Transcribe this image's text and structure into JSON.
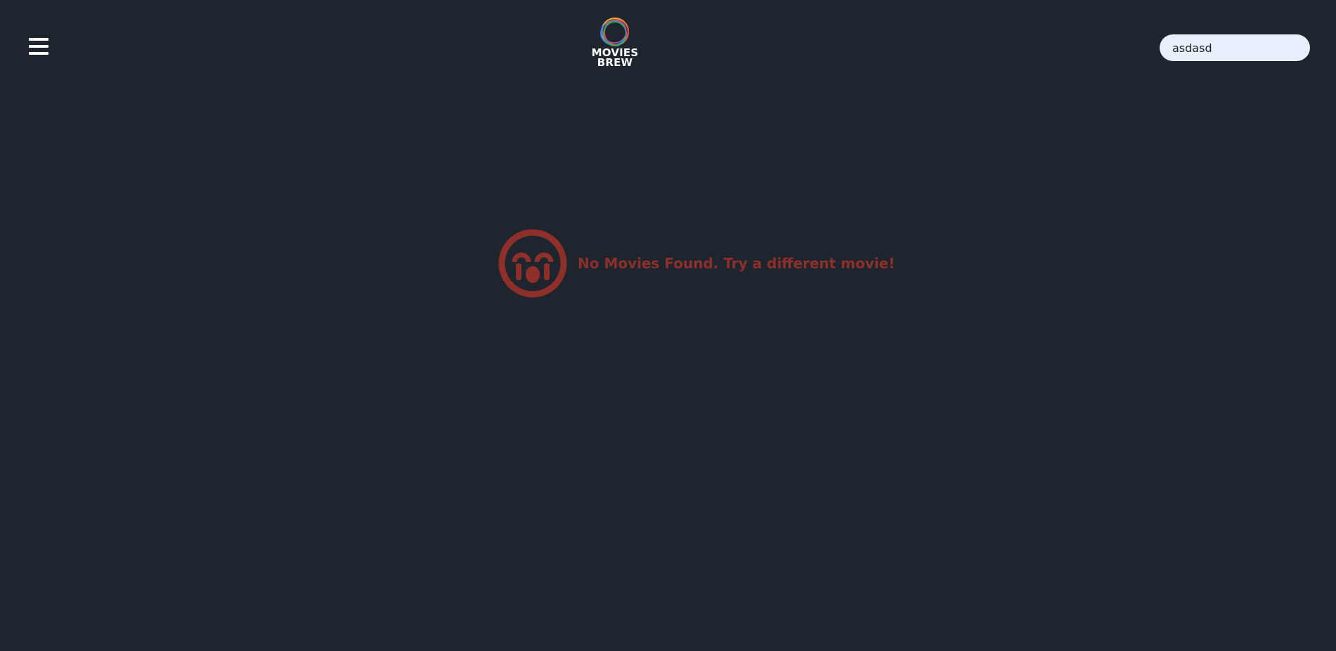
{
  "app": {
    "title_line1": "MOVIES",
    "title_line2": "BREW"
  },
  "header": {
    "menu_icon": "hamburger-menu-icon",
    "logo_icon": "overlapping-circles-logo-icon"
  },
  "search": {
    "value": "asdasd",
    "placeholder": ""
  },
  "empty_state": {
    "icon": "crying-face-icon",
    "message": "No Movies Found. Try a different movie!"
  },
  "colors": {
    "background": "#1f252e",
    "accent_error": "#8e2f2a",
    "search_bg": "#e8f0fe",
    "text_light": "#ffffff"
  }
}
